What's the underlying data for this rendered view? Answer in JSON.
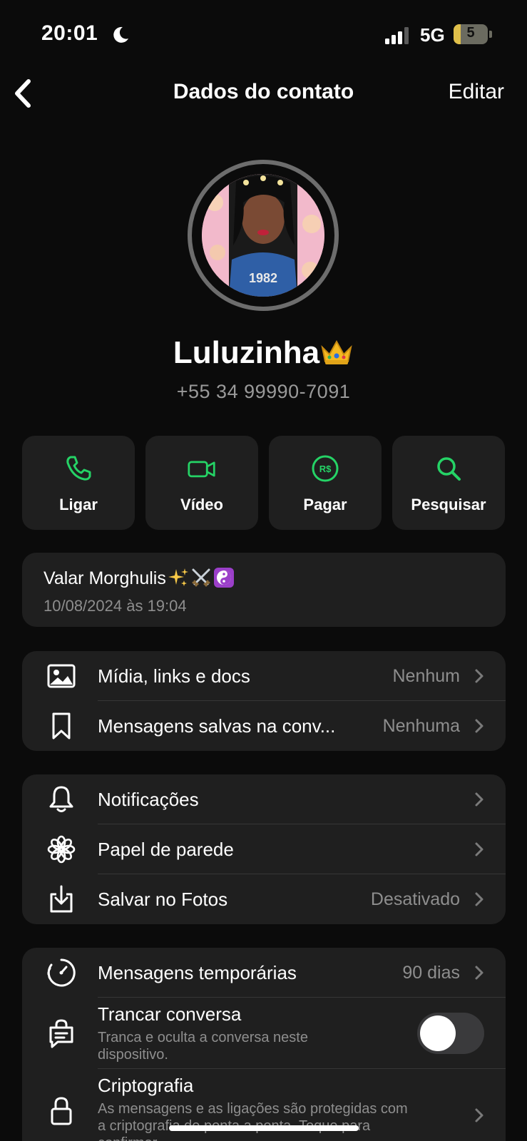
{
  "status_bar": {
    "time": "20:01",
    "network": "5G",
    "battery": "5",
    "battery_level": 0.05,
    "icons": [
      "moon-icon",
      "signal-icon",
      "battery-icon"
    ]
  },
  "nav": {
    "title": "Dados do contato",
    "edit_label": "Editar",
    "back_icon": "chevron-left-icon"
  },
  "contact": {
    "name": "Luluzinha",
    "name_emoji": "crown-emoji",
    "phone": "+55 34 99990-7091"
  },
  "actions": [
    {
      "label": "Ligar",
      "icon": "phone-icon"
    },
    {
      "label": "Vídeo",
      "icon": "video-icon"
    },
    {
      "label": "Pagar",
      "icon": "pay-icon",
      "icon_text": "R$"
    },
    {
      "label": "Pesquisar",
      "icon": "search-icon"
    }
  ],
  "about": {
    "text": "Valar Morghulis",
    "emojis": [
      "sparkles-emoji",
      "crossed-swords-emoji",
      "yin-yang-emoji"
    ],
    "date": "10/08/2024 às 19:04"
  },
  "group1": [
    {
      "label": "Mídia, links e docs",
      "value": "Nenhum",
      "icon": "image-icon"
    },
    {
      "label": "Mensagens salvas na conv...",
      "value": "Nenhuma",
      "icon": "bookmark-icon"
    }
  ],
  "group2": [
    {
      "label": "Notificações",
      "value": "",
      "icon": "bell-icon"
    },
    {
      "label": "Papel de parede",
      "value": "",
      "icon": "flower-icon"
    },
    {
      "label": "Salvar no Fotos",
      "value": "Desativado",
      "icon": "download-icon"
    }
  ],
  "group3": {
    "disappearing": {
      "label": "Mensagens temporárias",
      "value": "90 dias",
      "icon": "timer-icon"
    },
    "lock_chat": {
      "label": "Trancar conversa",
      "sub_line1": "Tranca e oculta a conversa neste",
      "sub_line2": "dispositivo.",
      "enabled": false,
      "icon": "lock-chat-icon"
    },
    "encryption": {
      "label": "Criptografia",
      "sub_line1": "As mensagens e as ligações são protegidas com",
      "sub_line2": "a criptografia de ponta a ponta. Toque para",
      "sub_line3": "confirmar.",
      "icon": "lock-icon"
    }
  },
  "colors": {
    "accent": "#25d366",
    "background": "#0b0b0b",
    "card": "#1f1f1f",
    "secondary_text": "#8e8e8e"
  }
}
